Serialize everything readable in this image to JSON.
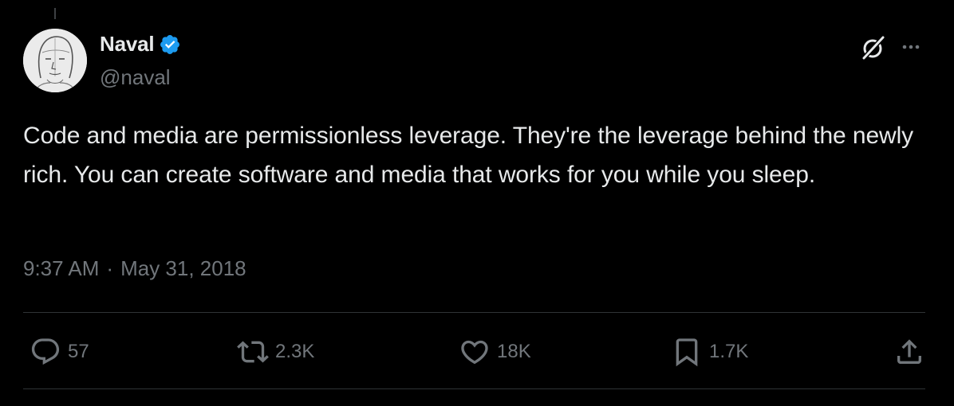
{
  "tweet": {
    "author": {
      "display_name": "Naval",
      "handle": "@naval",
      "verified": true,
      "verified_color": "#1d9bf0"
    },
    "text": "Code and media are permissionless leverage. They're the leverage behind the newly rich. You can create software and media that works for you while you sleep.",
    "time": "9:37 AM",
    "separator": "·",
    "date": "May 31, 2018"
  },
  "header_icons": {
    "grok": "grok-icon",
    "more": "more-icon"
  },
  "actions": {
    "reply": {
      "icon": "reply-icon",
      "count": "57"
    },
    "repost": {
      "icon": "repost-icon",
      "count": "2.3K"
    },
    "like": {
      "icon": "heart-icon",
      "count": "18K"
    },
    "bookmark": {
      "icon": "bookmark-icon",
      "count": "1.7K"
    },
    "share": {
      "icon": "share-icon"
    }
  },
  "colors": {
    "background": "#000000",
    "primary_text": "#e7e9ea",
    "secondary_text": "#71767b",
    "divider": "#2f3336"
  }
}
